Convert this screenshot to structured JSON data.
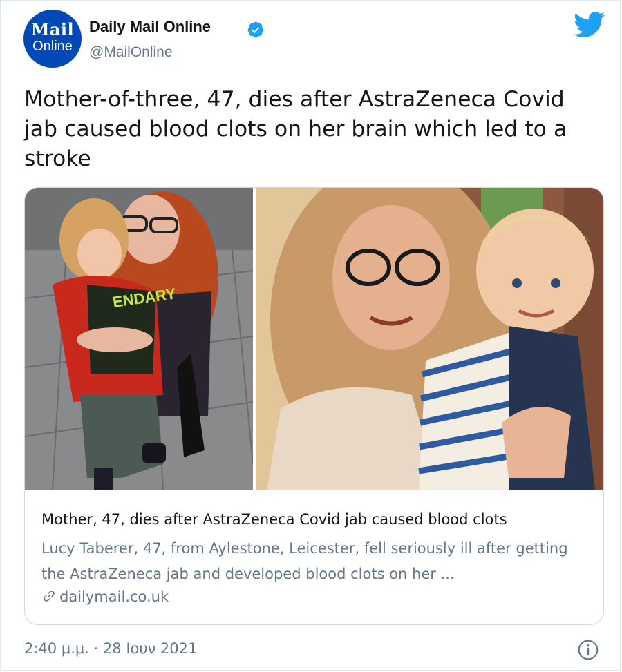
{
  "account": {
    "name": "Daily Mail Online",
    "handle": "@MailOnline",
    "avatar_line1": "Mail",
    "avatar_line2": "Online",
    "verified": true
  },
  "tweet": {
    "text": "Mother-of-three, 47, dies after AstraZeneca Covid jab caused blood clots on her brain which led to a stroke",
    "timestamp": "2:40 μ.μ. · 28 Ιουν 2021"
  },
  "card": {
    "title": "Mother, 47, dies after AstraZeneca Covid jab caused blood clots",
    "description": "Lucy Taberer, 47, from Aylestone, Leicester, fell seriously ill after getting the AstraZeneca jab and developed blood clots on her ...",
    "domain": "dailymail.co.uk",
    "image_left_shirt_text": "ENDARY"
  },
  "icons": {
    "brand": "twitter-bird-icon",
    "verified": "verified-badge-icon",
    "link": "link-icon",
    "info": "info-icon"
  },
  "colors": {
    "twitter_blue": "#1da1f2",
    "avatar_blue": "#0049b7",
    "secondary_text": "#657786",
    "border": "#cfd9de"
  }
}
